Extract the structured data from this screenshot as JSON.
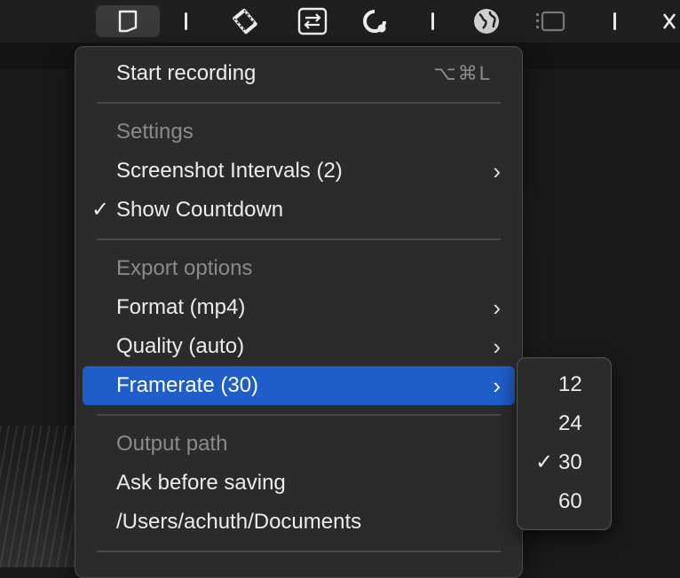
{
  "menu": {
    "start_recording": {
      "label": "Start recording",
      "shortcut": "⌥⌘L"
    },
    "settings_header": "Settings",
    "screenshot_intervals": "Screenshot Intervals (2)",
    "show_countdown": {
      "label": "Show Countdown",
      "checked": true,
      "check": "✓"
    },
    "export_header": "Export options",
    "format": "Format (mp4)",
    "quality": "Quality (auto)",
    "framerate": "Framerate (30)",
    "output_header": "Output path",
    "ask_before_saving": "Ask before saving",
    "path": "/Users/achuth/Documents",
    "chevron": "›"
  },
  "framerate_submenu": {
    "options": [
      "12",
      "24",
      "30",
      "60"
    ],
    "selected": "30",
    "check": "✓"
  },
  "colors": {
    "highlight": "#1f5ec9",
    "menu_bg": "#2b2b2b",
    "header_text": "#8a8a8a"
  },
  "menubar_icons": [
    "crop-frame-icon",
    "film-strip-icon",
    "swap-arrows-icon",
    "refresh-circle-icon",
    "globe-icon",
    "sidebar-toggle-icon",
    "close-x-icon"
  ]
}
